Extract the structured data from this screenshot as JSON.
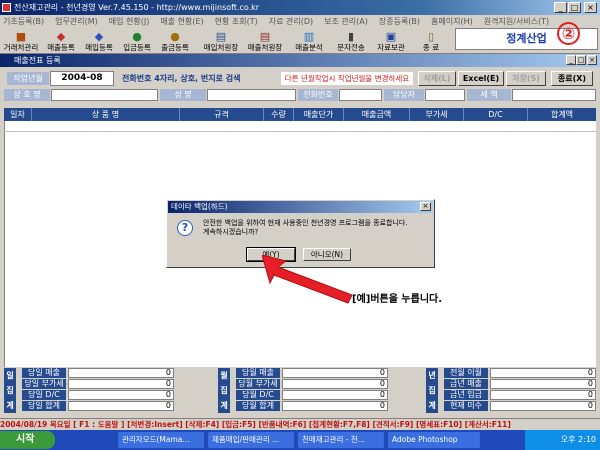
{
  "window": {
    "title": "전산재고관리 - 천년경영 Ver.7.45.150 - http://www.mijinsoft.co.kr",
    "min": "_",
    "max": "□",
    "close": "×"
  },
  "menu": [
    "기초등록(B)",
    "업무관리(M)",
    "매입 현황(J)",
    "매출 현황(E)",
    "현황 조회(T)",
    "자료 관리(D)",
    "보조 관리(A)",
    "장종등록(B)",
    "홈페이지(H)",
    "원격지원/서비스(T)"
  ],
  "toolbar": [
    "거래처관리",
    "매출등록",
    "매입등록",
    "입금등록",
    "출금등록",
    "매입처원장",
    "매출처원장",
    "매출분석",
    "문자전송",
    "자료보관",
    "종 료"
  ],
  "brand": "정계산업",
  "badge": "②",
  "subwindow": {
    "title": "매출전표 등록"
  },
  "form": {
    "date_label": "작업년월",
    "date_value": "2004-08",
    "hint": "전화번호 4자리, 상호, 번지로 검색",
    "warn": "다른 년월작업시 작업년월을 변경하세요",
    "delete_btn": "삭제(L)",
    "excel_btn": "Excel(E)",
    "save_btn": "저장(S)",
    "close_btn": "종료(X)",
    "name_label": "상 호 명",
    "owner_label": "성 명",
    "phone_label": "전화번호",
    "manager_label": "담당자",
    "tax_label": "세 액"
  },
  "grid": {
    "headers": [
      "일자",
      "상 품 명",
      "규격",
      "수량",
      "매출단가",
      "매출금액",
      "부가세",
      "D/C",
      "합계액"
    ]
  },
  "dialog": {
    "title": "데이타 백업(하드)",
    "line1": "안전한 백업을 위하여 현재 사용중인 천년경영 프로그램을 종료합니다.",
    "line2": "계속하시겠습니까?",
    "yes": "예(Y)",
    "no": "아니오(N)"
  },
  "callout": "[예]버튼을 누릅니다.",
  "summary": {
    "left": {
      "side": "일\n집\n계",
      "rows": [
        {
          "l": "당일 매출",
          "v": "0"
        },
        {
          "l": "당일 부가세",
          "v": "0"
        },
        {
          "l": "당일 D/C",
          "v": "0"
        },
        {
          "l": "당일 합계",
          "v": "0"
        }
      ]
    },
    "mid": {
      "side": "월\n집\n계",
      "rows": [
        {
          "l": "당월 매출",
          "v": "0"
        },
        {
          "l": "당월 부가세",
          "v": "0"
        },
        {
          "l": "당월 D/C",
          "v": "0"
        },
        {
          "l": "당월 합계",
          "v": "0"
        }
      ]
    },
    "right": {
      "side": "년\n집\n계",
      "rows": [
        {
          "l": "전월 이월",
          "v": "0"
        },
        {
          "l": "금년 매출",
          "v": "0"
        },
        {
          "l": "금년 입금",
          "v": "0"
        },
        {
          "l": "현재 미수",
          "v": "0"
        }
      ]
    }
  },
  "status": "2004/08/19 목요일  [ F1 : 도움말 ] [처변경:Insert] [삭제:F4] [입금:F5] [반품내역:F6] [접계현황:F7,F8] [견적서:F9] [명세표:F10] [계산서:F11]",
  "taskbar": {
    "start": "시작",
    "items": [
      "관리자모드(Mama...",
      "제품매입/판매관리 ...",
      "천매재고관리 - 천...",
      "Adobe Photoshop"
    ],
    "clock": "오후 2:10"
  }
}
